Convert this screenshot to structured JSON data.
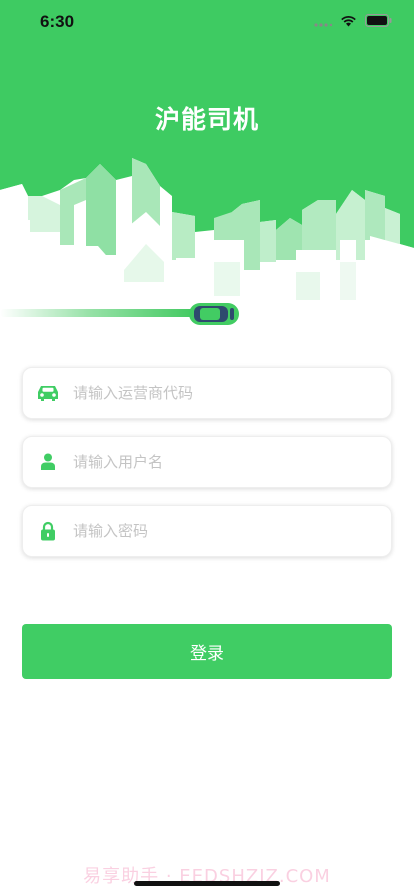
{
  "status_bar": {
    "time": "6:30"
  },
  "app": {
    "title": "沪能司机"
  },
  "form": {
    "operator_code": {
      "placeholder": "请输入运营商代码",
      "value": ""
    },
    "username": {
      "placeholder": "请输入用户名",
      "value": ""
    },
    "password": {
      "placeholder": "请输入密码",
      "value": ""
    }
  },
  "login_button": {
    "label": "登录"
  },
  "watermark": "易享助手 · EEDSHZIZ.COM",
  "icons": {
    "field_1": "car-icon",
    "field_2": "user-icon",
    "field_3": "lock-icon",
    "status": [
      "signal-icon",
      "wifi-icon",
      "battery-icon"
    ]
  },
  "colors": {
    "brand_green": "#40cd64",
    "car_body": "#2e4a6e"
  }
}
